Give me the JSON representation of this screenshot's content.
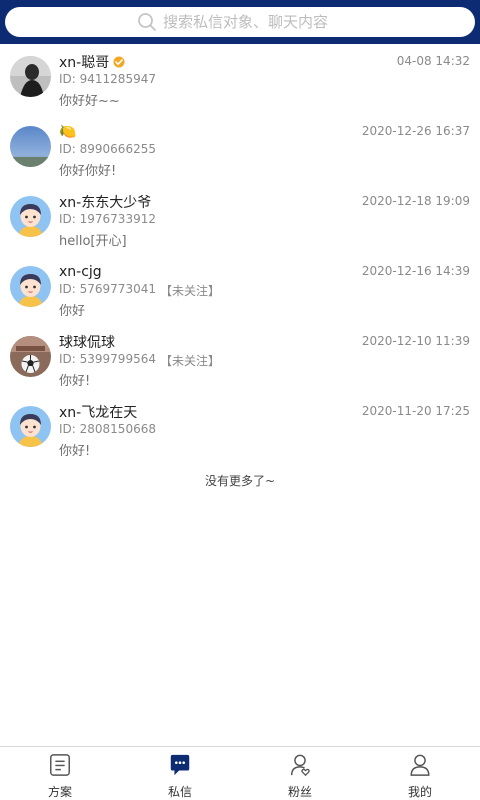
{
  "search": {
    "placeholder": "搜索私信对象、聊天内容"
  },
  "colors": {
    "header": "#0c2b73",
    "active_tab": "#0c2b73",
    "verified_badge": "#f5a623"
  },
  "conversations": [
    {
      "name": "xn-聪哥",
      "verified": true,
      "time": "04-08 14:32",
      "id": "ID: 9411285947",
      "tag": "",
      "message": "你好好~~",
      "avatar": "photo-dark-icon"
    },
    {
      "name": "🍋",
      "verified": false,
      "time": "2020-12-26 16:37",
      "id": "ID: 8990666255",
      "tag": "",
      "message": "你好你好!",
      "avatar": "sky-photo-icon"
    },
    {
      "name": "xn-东东大少爷",
      "verified": false,
      "time": "2020-12-18 19:09",
      "id": "ID: 1976733912",
      "tag": "",
      "message": "hello[开心]",
      "avatar": "cartoon-boy-icon"
    },
    {
      "name": "xn-cjg",
      "verified": false,
      "time": "2020-12-16 14:39",
      "id": "ID: 5769773041",
      "tag": "【未关注】",
      "message": "你好",
      "avatar": "cartoon-boy-icon"
    },
    {
      "name": "球球侃球",
      "verified": false,
      "time": "2020-12-10 11:39",
      "id": "ID: 5399799564",
      "tag": "【未关注】",
      "message": "你好!",
      "avatar": "soccer-photo-icon"
    },
    {
      "name": "xn-飞龙在天",
      "verified": false,
      "time": "2020-11-20 17:25",
      "id": "ID: 2808150668",
      "tag": "",
      "message": "你好!",
      "avatar": "cartoon-boy-icon"
    }
  ],
  "no_more": "没有更多了~",
  "tabs": [
    {
      "label": "方案",
      "icon": "document-icon",
      "active": false
    },
    {
      "label": "私信",
      "icon": "chat-bubble-icon",
      "active": true
    },
    {
      "label": "粉丝",
      "icon": "fans-icon",
      "active": false
    },
    {
      "label": "我的",
      "icon": "profile-icon",
      "active": false
    }
  ]
}
